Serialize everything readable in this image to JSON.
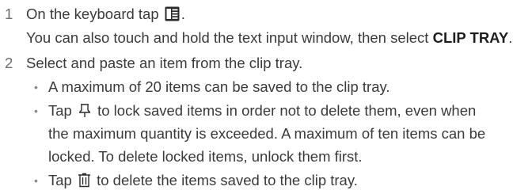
{
  "steps": [
    {
      "number": "1",
      "text_before_icon": "On the keyboard tap ",
      "icon": "clip-tray-icon",
      "text_after_icon": ".",
      "note_prefix": "You can also touch and hold the text input window, then select ",
      "note_bold": "CLIP TRAY",
      "note_suffix": "."
    },
    {
      "number": "2",
      "text": "Select and paste an item from the clip tray."
    }
  ],
  "bullets": {
    "symbol": "•",
    "b1": "A maximum of 20 items can be saved to the clip tray.",
    "b2_before_icon": "Tap ",
    "b2_icon": "lock-pin-icon",
    "b2_after_icon": " to lock saved items in order not to delete them, even when",
    "b2_line2": "the maximum quantity is exceeded. A maximum of ten items can be",
    "b2_line3": "locked. To delete locked items, unlock them first.",
    "b3_before_icon": "Tap ",
    "b3_icon": "trash-icon",
    "b3_after_icon": " to delete the items saved to the clip tray."
  }
}
